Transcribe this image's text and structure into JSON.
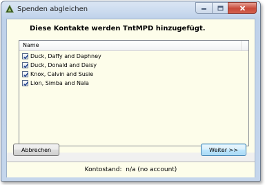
{
  "window": {
    "title": "Spenden abgleichen"
  },
  "heading": "Diese Kontakte werden TntMPD hinzugefügt.",
  "list": {
    "column_header": "Name",
    "items": [
      {
        "label": "Duck, Daffy and Daphney",
        "checked": true
      },
      {
        "label": "Duck, Donald and Daisy",
        "checked": true
      },
      {
        "label": "Knox, Calvin and Susie",
        "checked": true
      },
      {
        "label": "Lion, Simba and Nala",
        "checked": true
      }
    ]
  },
  "buttons": {
    "cancel_label": "Abbrechen",
    "next_label": "Weiter >>"
  },
  "status": {
    "text": "Kontostand:  n/a (no account)"
  },
  "colors": {
    "panel_background": "#fdfdea",
    "close_button": "#c94a3a",
    "default_button_border": "#3c7fb1"
  }
}
